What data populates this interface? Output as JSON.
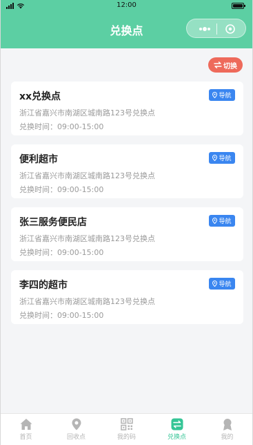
{
  "status_bar": {
    "time": "12:00"
  },
  "header": {
    "title": "兑换点",
    "background_color": "#5ccfa3",
    "capsule_icons": [
      "more-dots-icon",
      "close-circle-icon"
    ]
  },
  "switch_button": {
    "label": "切换",
    "icon": "swap-arrows-icon",
    "color": "#ee6a5b"
  },
  "stores": [
    {
      "name": "xx兑换点",
      "nav_label": "导航",
      "address": "浙江省嘉兴市南湖区城南路123号兑换点",
      "hours": "兑换时间：09:00-15:00"
    },
    {
      "name": "便利超市",
      "nav_label": "导航",
      "address": "浙江省嘉兴市南湖区城南路123号兑换点",
      "hours": "兑换时间：09:00-15:00"
    },
    {
      "name": "张三服务便民店",
      "nav_label": "导航",
      "address": "浙江省嘉兴市南湖区城南路123号兑换点",
      "hours": "兑换时间：09:00-15:00"
    },
    {
      "name": "李四的超市",
      "nav_label": "导航",
      "address": "浙江省嘉兴市南湖区城南路123号兑换点",
      "hours": "兑换时间：09:00-15:00"
    }
  ],
  "nav_button_color": "#3a86f0",
  "tabbar": {
    "items": [
      {
        "label": "首页",
        "icon": "home-icon",
        "active": false
      },
      {
        "label": "回收点",
        "icon": "location-pin-icon",
        "active": false
      },
      {
        "label": "我的码",
        "icon": "qr-code-icon",
        "active": false
      },
      {
        "label": "兑换点",
        "icon": "exchange-icon",
        "active": true
      },
      {
        "label": "我的",
        "icon": "user-icon",
        "active": false
      }
    ],
    "active_color": "#35c596",
    "inactive_color": "#b5b5b5"
  }
}
